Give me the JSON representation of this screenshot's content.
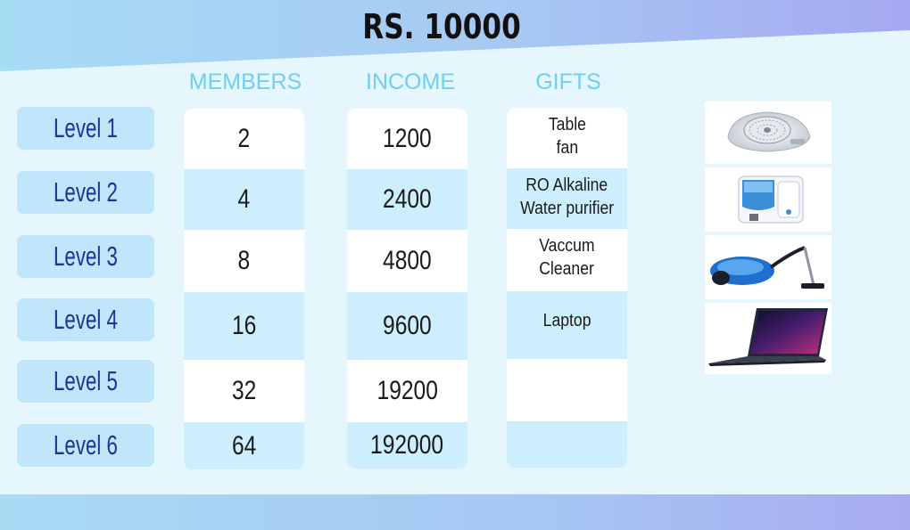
{
  "title": "RS. 10000",
  "headers": {
    "members": "MEMBERS",
    "income": "INCOME",
    "gifts": "GIFTS"
  },
  "levels": [
    "Level 1",
    "Level 2",
    "Level 3",
    "Level 4",
    "Level 5",
    "Level 6"
  ],
  "members": [
    "2",
    "4",
    "8",
    "16",
    "32",
    "64"
  ],
  "income": [
    "1200",
    "2400",
    "4800",
    "9600",
    "19200",
    "192000"
  ],
  "gifts": [
    [
      "Table",
      "fan"
    ],
    [
      "RO Alkaline",
      "Water purifier"
    ],
    [
      "Vaccum",
      "Cleaner"
    ],
    [
      "Laptop",
      ""
    ],
    [
      "",
      ""
    ],
    [
      "",
      ""
    ]
  ],
  "product_images": [
    "table-fan-image",
    "water-purifier-image",
    "vacuum-cleaner-image",
    "laptop-image"
  ],
  "colors": {
    "header_text": "#6dd0f1",
    "level_text": "#1d3696",
    "level_bg": "#bfe6fb",
    "cell_blue": "#cdeefd"
  }
}
